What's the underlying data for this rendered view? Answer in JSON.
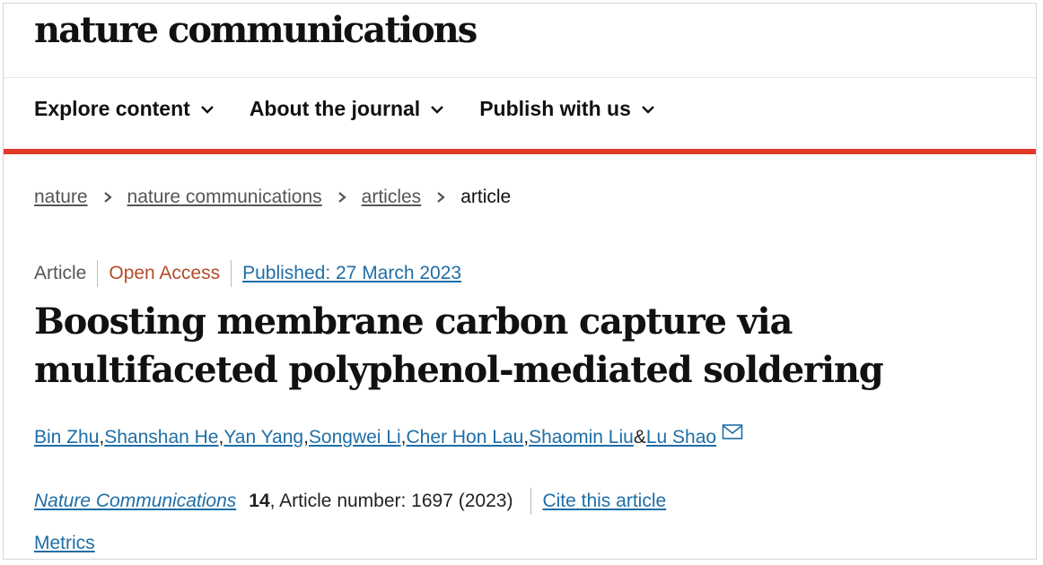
{
  "site": {
    "logo_text": "nature communications"
  },
  "nav": {
    "items": [
      {
        "label": "Explore content",
        "icon": "chevron-down-icon"
      },
      {
        "label": "About the journal",
        "icon": "chevron-down-icon"
      },
      {
        "label": "Publish with us",
        "icon": "chevron-down-icon"
      }
    ]
  },
  "breadcrumb": {
    "items": [
      "nature",
      "nature communications",
      "articles"
    ],
    "current": "article"
  },
  "article": {
    "type": "Article",
    "access": "Open Access",
    "published": "Published: 27 March 2023",
    "title": "Boosting membrane carbon capture via multifaceted polyphenol-mediated soldering",
    "authors": [
      "Bin Zhu",
      "Shanshan He",
      "Yan Yang",
      "Songwei Li",
      "Cher Hon Lau",
      "Shaomin Liu",
      "Lu Shao"
    ],
    "author_separator": ", ",
    "author_last_separator": " & ",
    "journal": "Nature Communications",
    "volume": "14",
    "article_number_text": ", Article number: 1697 (2023)",
    "cite_label": "Cite this article",
    "metrics_label": "Metrics"
  },
  "colors": {
    "accent_red": "#e23a28",
    "link_blue": "#1e6ea6",
    "open_access": "#b44b2b"
  }
}
